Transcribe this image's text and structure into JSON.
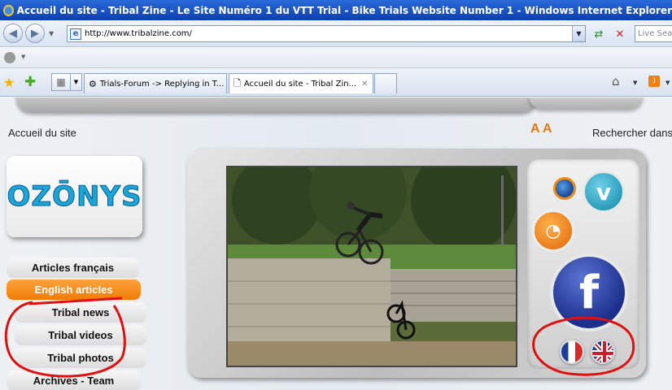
{
  "window": {
    "title": "Accueil du site - Tribal Zine - Le Site Numéro 1 du VTT Trial - Bike Trials Website Number 1 - Windows Internet Explorer"
  },
  "addressbar": {
    "url": "http://www.tribalzine.com/",
    "search_placeholder": "Live Search"
  },
  "tabs": [
    {
      "label": "Trials-Forum -> Replying in T..."
    },
    {
      "label": "Accueil du site - Tribal Zin..."
    }
  ],
  "page": {
    "breadcrumb": "Accueil du site",
    "font_controls": "A A",
    "search_label": "Rechercher dans",
    "logo_text": "OZŌNYS",
    "menu": [
      {
        "label": "Articles français"
      },
      {
        "label": "English articles"
      },
      {
        "label": "Tribal news"
      },
      {
        "label": "Tribal videos"
      },
      {
        "label": "Tribal photos"
      },
      {
        "label": "Archives - Team"
      }
    ]
  },
  "colors": {
    "accent": "#f07c06",
    "annotation": "#e01010",
    "titlebar": "#0d3fb0"
  }
}
